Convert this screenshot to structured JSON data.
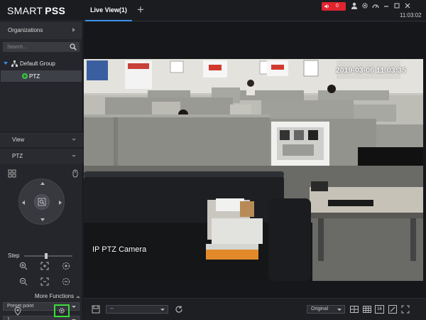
{
  "app": {
    "logo_regular": "SMART",
    "logo_bold": "PSS"
  },
  "tabs": [
    {
      "label": "Live View(1)"
    }
  ],
  "titlebar": {
    "add_tab": "+",
    "alarm_count": "0",
    "clock": "11:03:02"
  },
  "sidebar": {
    "organizations_label": "Organizations",
    "search_placeholder": "Search...",
    "group_label": "Default Group",
    "device_label": "PTZ",
    "view_label": "View",
    "ptz_label": "PTZ",
    "step_label": "Step",
    "step_level": 0.45,
    "more_functions_label": "More Functions",
    "preset_select": "Preset point",
    "preset_value": "1"
  },
  "video": {
    "camera_label": "IP PTZ Camera",
    "osd_timestamp": "2019-03-06 11:03:35"
  },
  "toolbar": {
    "window_select": "--",
    "ratio_select": "Original",
    "grid_label": "16"
  },
  "colors": {
    "accent": "#3a8ee6",
    "alarm": "#e0242e",
    "highlight": "#3cdc3c"
  }
}
